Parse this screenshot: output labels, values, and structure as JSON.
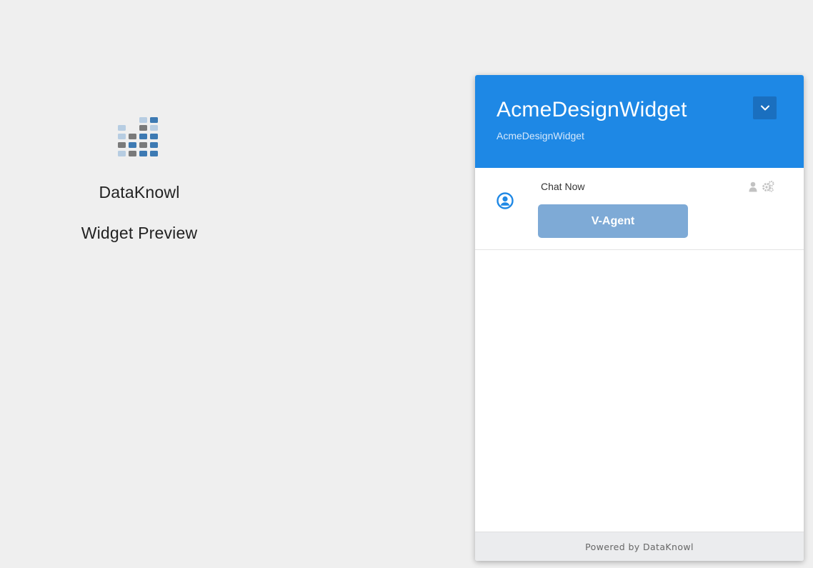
{
  "preview": {
    "brand": "DataKnowl",
    "label": "Widget Preview",
    "logo_icon": "dataknowl-logo-icon"
  },
  "widget": {
    "title": "AcmeDesignWidget",
    "subtitle": "AcmeDesignWidget",
    "header_color": "#1e88e5",
    "collapse_icon": "chevron-down-icon",
    "chat": {
      "label": "Chat Now",
      "button_label": "V-Agent",
      "button_color": "#7eaad6",
      "avatar_icon": "user-circle-icon",
      "status_icons": [
        "user-icon",
        "gears-icon"
      ]
    },
    "footer": "Powered by DataKnowl"
  }
}
